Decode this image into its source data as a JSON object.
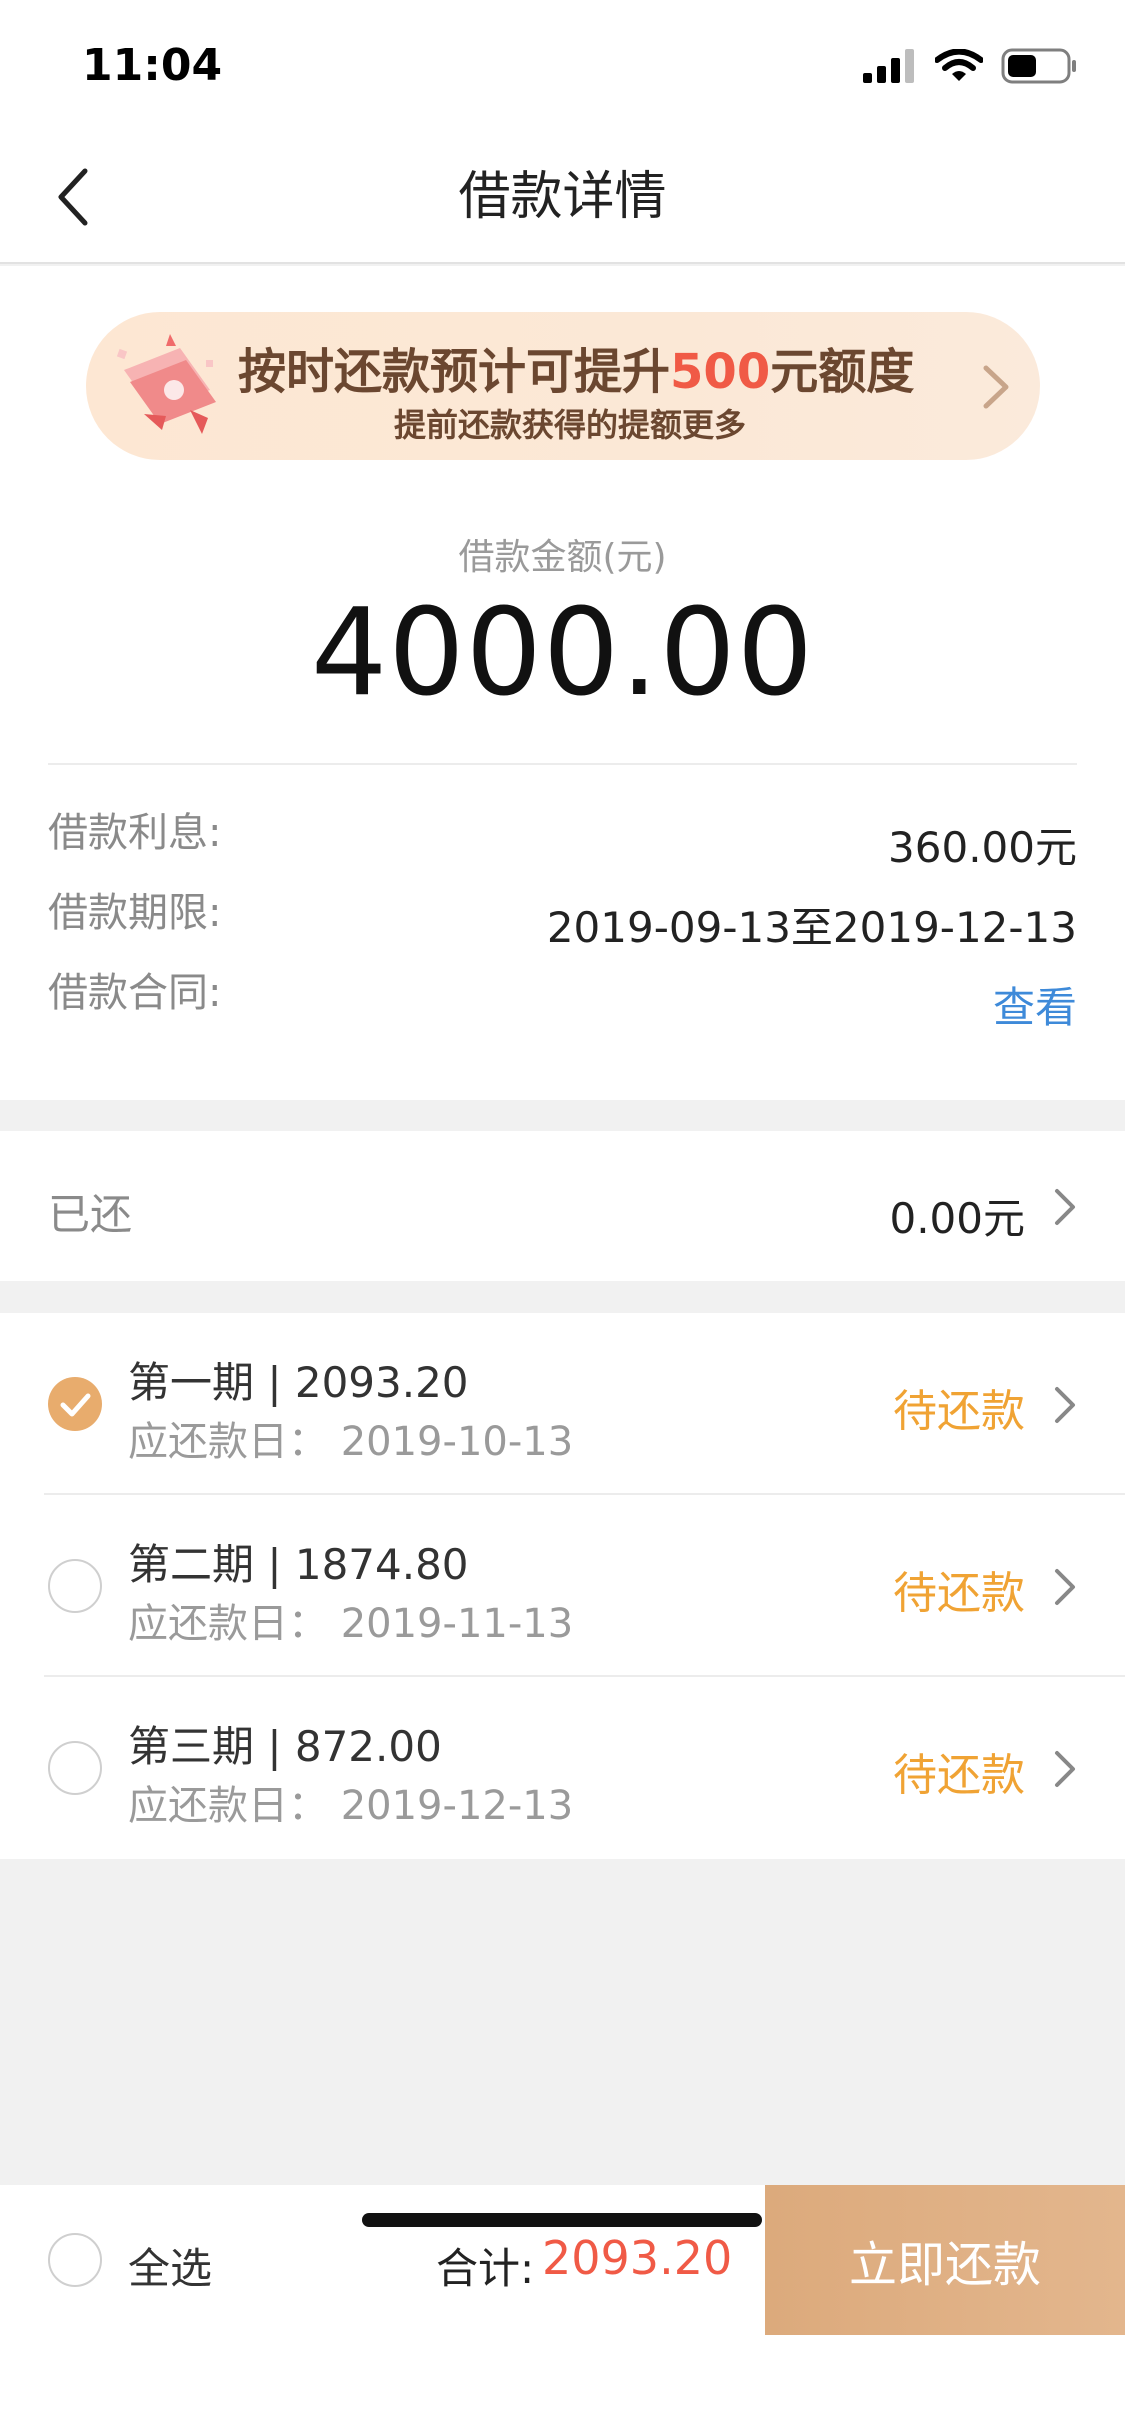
{
  "status_bar": {
    "time": "11:04"
  },
  "nav": {
    "title": "借款详情"
  },
  "banner": {
    "line1_prefix": "按时还款预计可提升",
    "line1_highlight": "500",
    "line1_suffix": "元额度",
    "line2": "提前还款获得的提额更多"
  },
  "loan": {
    "amount_label": "借款金额(元)",
    "amount_value": "4000.00",
    "details": [
      {
        "label": "借款利息:",
        "value": "360.00元"
      },
      {
        "label": "借款期限:",
        "value": "2019-09-13至2019-12-13"
      },
      {
        "label": "借款合同:",
        "value": "查看"
      }
    ]
  },
  "paid": {
    "label": "已还",
    "value": "0.00元"
  },
  "installments": [
    {
      "title": "第一期 | 2093.20",
      "date": "应还款日：  2019-10-13",
      "status": "待还款",
      "checked": true
    },
    {
      "title": "第二期 | 1874.80",
      "date": "应还款日：  2019-11-13",
      "status": "待还款",
      "checked": false
    },
    {
      "title": "第三期 | 872.00",
      "date": "应还款日：  2019-12-13",
      "status": "待还款",
      "checked": false
    }
  ],
  "bottom": {
    "select_all": "全选",
    "total_label": "合计:",
    "total_value": "2093.20",
    "pay_button": "立即还款"
  },
  "colors": {
    "accent_orange": "#f0a334",
    "highlight_red": "#f05a46",
    "link_blue": "#3e8ad9",
    "pay_button": "#dcaa7c"
  }
}
